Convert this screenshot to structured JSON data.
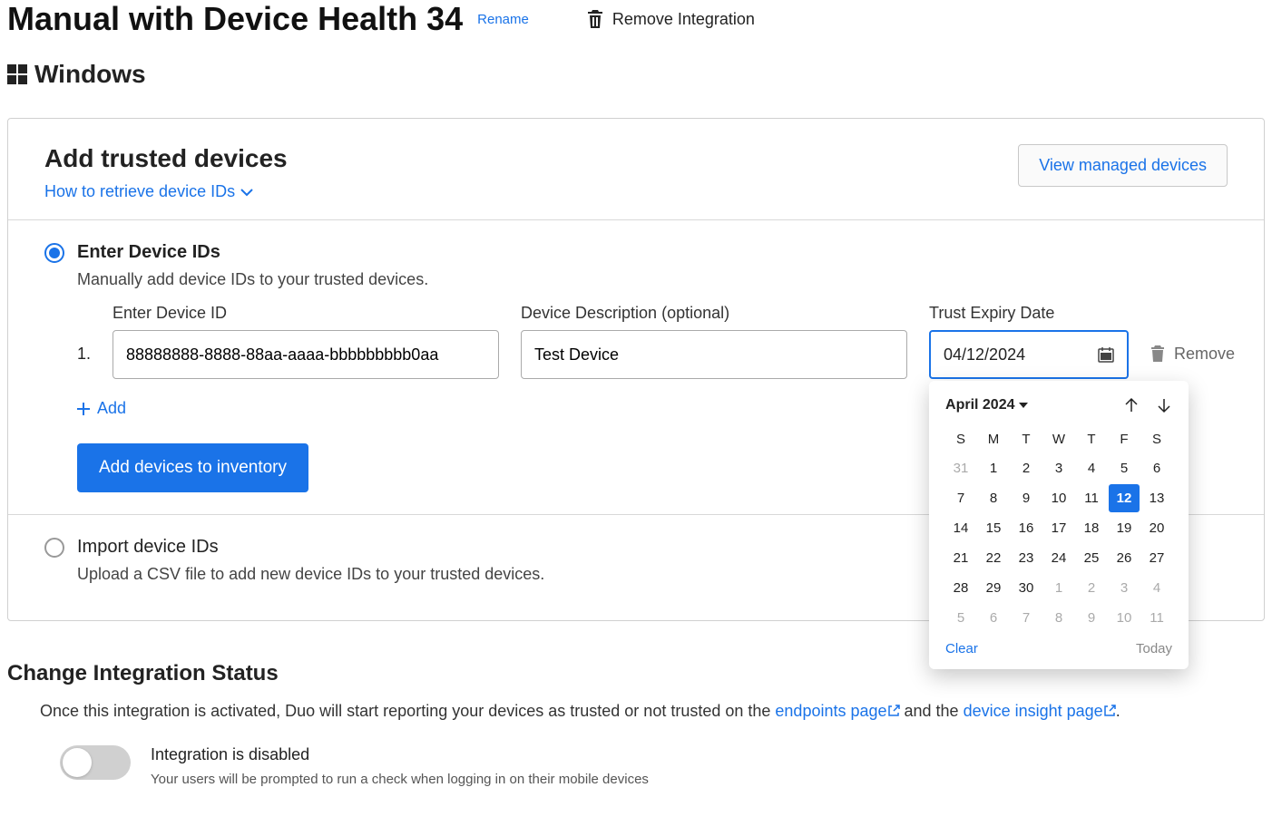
{
  "header": {
    "title": "Manual with Device Health 34",
    "rename_label": "Rename",
    "remove_label": "Remove Integration"
  },
  "platform": {
    "label": "Windows"
  },
  "card": {
    "title": "Add trusted devices",
    "retrieve_link": "How to retrieve device IDs",
    "view_managed_label": "View managed devices"
  },
  "enter_ids": {
    "radio_label": "Enter Device IDs",
    "radio_desc": "Manually add device IDs to your trusted devices.",
    "col_device_id": "Enter Device ID",
    "col_desc": "Device Description (optional)",
    "col_expiry": "Trust Expiry Date",
    "row_number": "1.",
    "device_id_value": "88888888-8888-88aa-aaaa-bbbbbbbbb0aa",
    "desc_value": "Test Device",
    "date_value": "04/12/2024",
    "remove_label": "Remove",
    "add_label": "Add",
    "submit_label": "Add devices to inventory"
  },
  "import_ids": {
    "radio_label": "Import device IDs",
    "radio_desc": "Upload a CSV file to add new device IDs to your trusted devices."
  },
  "calendar": {
    "month_label": "April 2024",
    "dow": [
      "S",
      "M",
      "T",
      "W",
      "T",
      "F",
      "S"
    ],
    "weeks": [
      [
        {
          "d": "31",
          "o": true
        },
        {
          "d": "1"
        },
        {
          "d": "2"
        },
        {
          "d": "3"
        },
        {
          "d": "4"
        },
        {
          "d": "5"
        },
        {
          "d": "6"
        }
      ],
      [
        {
          "d": "7"
        },
        {
          "d": "8"
        },
        {
          "d": "9"
        },
        {
          "d": "10"
        },
        {
          "d": "11"
        },
        {
          "d": "12",
          "sel": true
        },
        {
          "d": "13"
        }
      ],
      [
        {
          "d": "14"
        },
        {
          "d": "15"
        },
        {
          "d": "16"
        },
        {
          "d": "17"
        },
        {
          "d": "18"
        },
        {
          "d": "19"
        },
        {
          "d": "20"
        }
      ],
      [
        {
          "d": "21"
        },
        {
          "d": "22"
        },
        {
          "d": "23"
        },
        {
          "d": "24"
        },
        {
          "d": "25"
        },
        {
          "d": "26"
        },
        {
          "d": "27"
        }
      ],
      [
        {
          "d": "28"
        },
        {
          "d": "29"
        },
        {
          "d": "30"
        },
        {
          "d": "1",
          "o": true
        },
        {
          "d": "2",
          "o": true
        },
        {
          "d": "3",
          "o": true
        },
        {
          "d": "4",
          "o": true
        }
      ],
      [
        {
          "d": "5",
          "o": true
        },
        {
          "d": "6",
          "o": true
        },
        {
          "d": "7",
          "o": true
        },
        {
          "d": "8",
          "o": true
        },
        {
          "d": "9",
          "o": true
        },
        {
          "d": "10",
          "o": true
        },
        {
          "d": "11",
          "o": true
        }
      ]
    ],
    "clear_label": "Clear",
    "today_label": "Today"
  },
  "status": {
    "heading": "Change Integration Status",
    "desc_pre": "Once this integration is activated, Duo will start reporting your devices as trusted or not trusted on the ",
    "endpoints_link": "endpoints page",
    "desc_mid": " and the ",
    "insight_link": "device insight page",
    "desc_post": ".",
    "toggle_label": "Integration is disabled",
    "toggle_sub": "Your users will be prompted to run a check when logging in on their mobile devices"
  }
}
